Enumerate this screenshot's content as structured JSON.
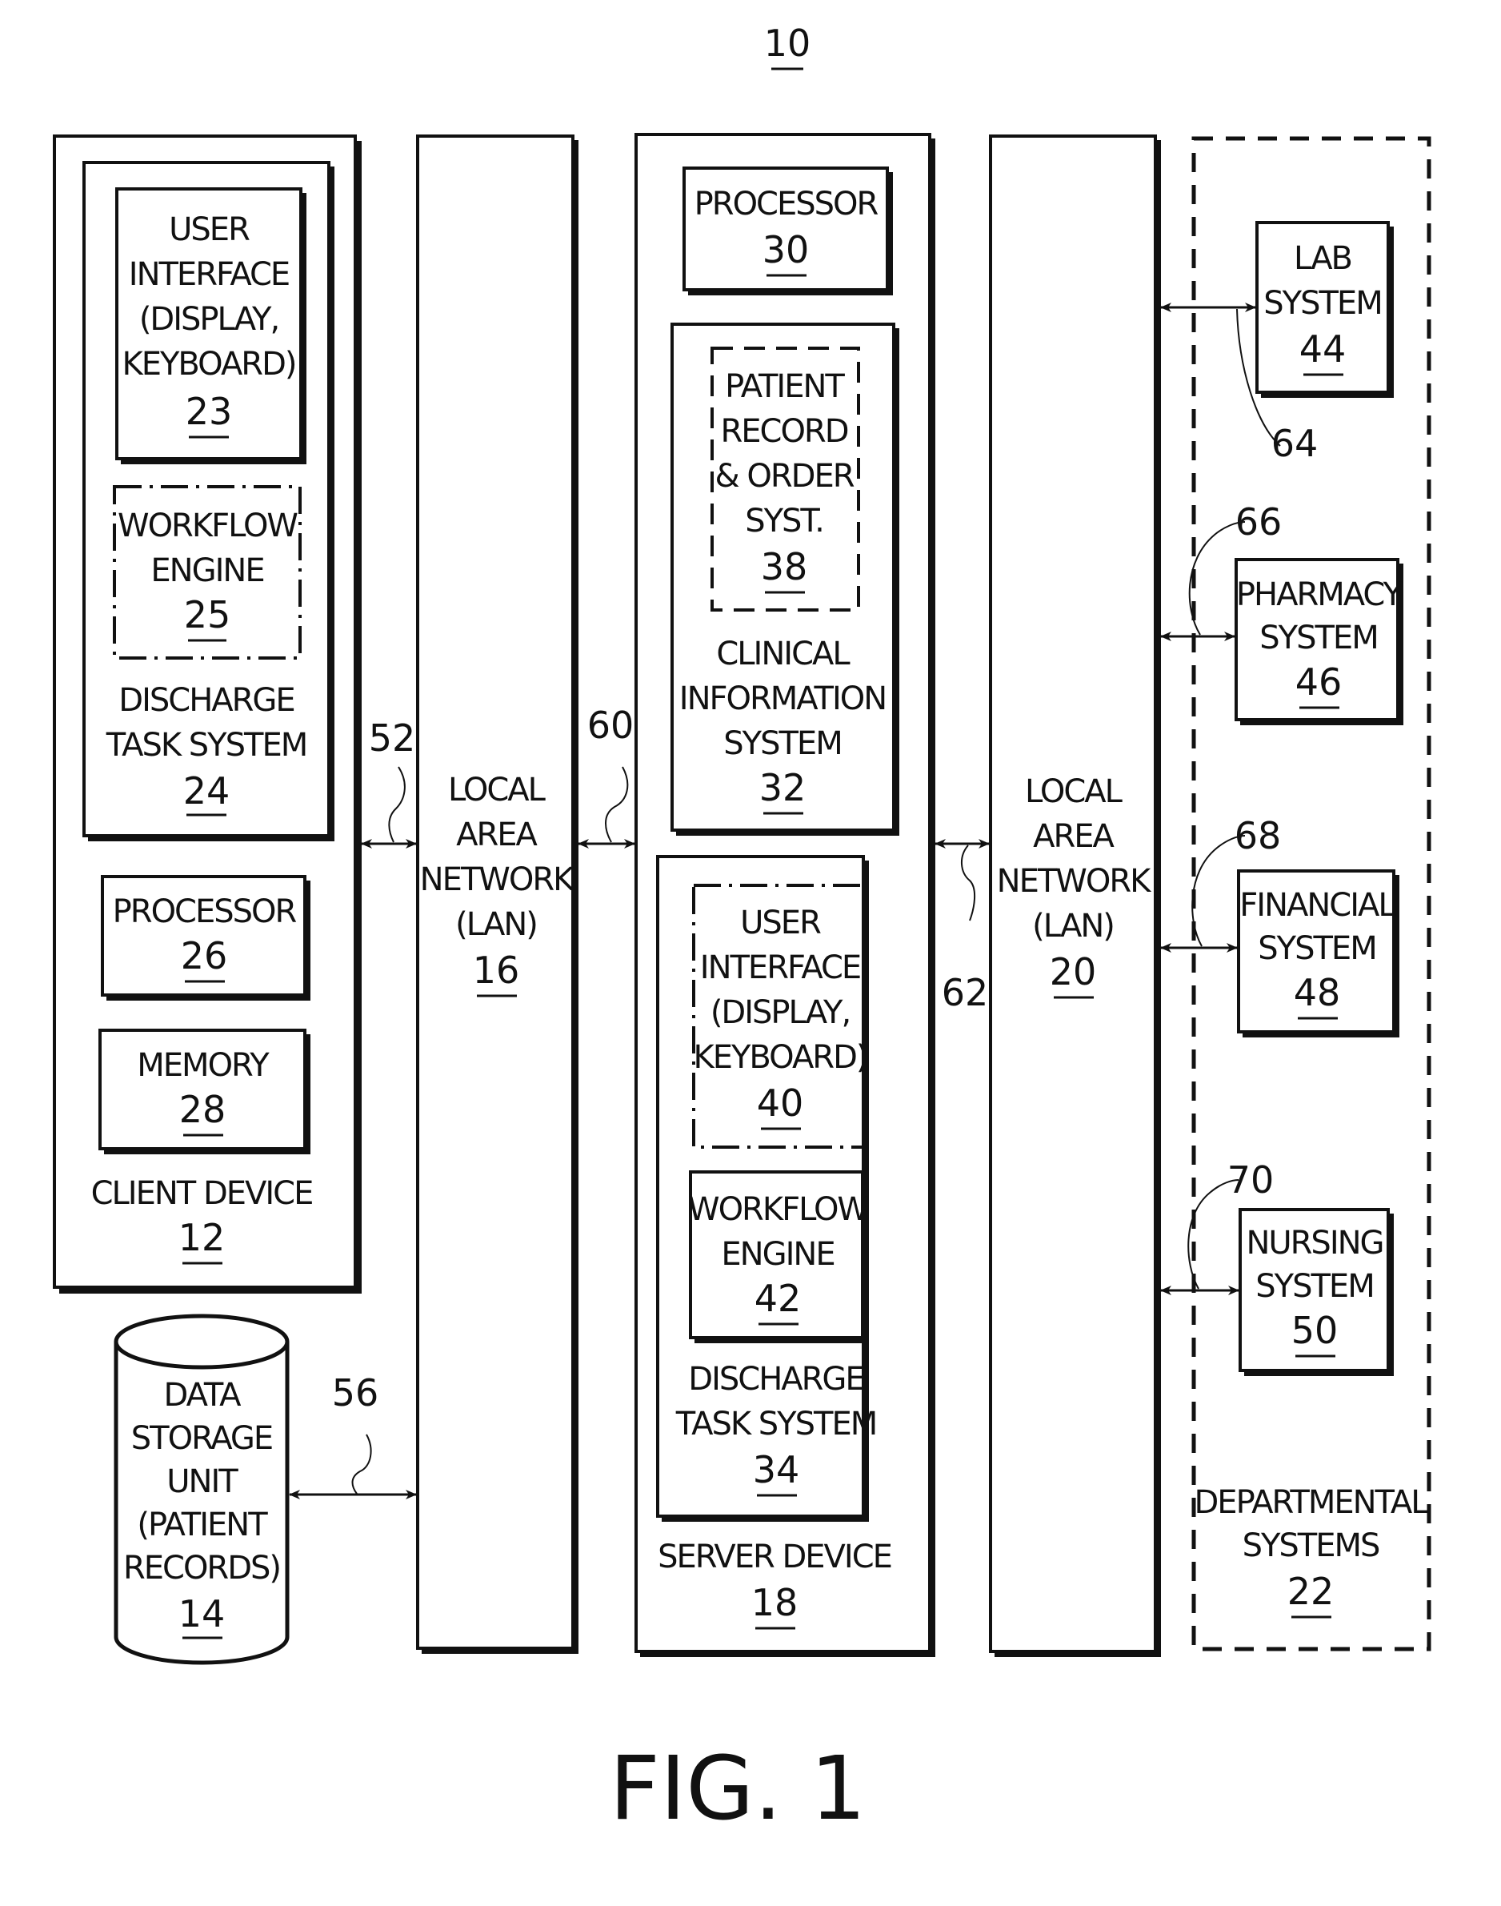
{
  "figure": {
    "reference": "10",
    "caption": "FIG. 1"
  },
  "client_device": {
    "label": "CLIENT DEVICE",
    "ref": "12",
    "discharge_task_system": {
      "lines": [
        "DISCHARGE",
        "TASK SYSTEM"
      ],
      "ref": "24",
      "user_interface": {
        "lines": [
          "USER",
          "INTERFACE",
          "(DISPLAY,",
          "KEYBOARD)"
        ],
        "ref": "23"
      },
      "workflow_engine": {
        "lines": [
          "WORKFLOW",
          "ENGINE"
        ],
        "ref": "25"
      }
    },
    "processor": {
      "label": "PROCESSOR",
      "ref": "26"
    },
    "memory": {
      "label": "MEMORY",
      "ref": "28"
    }
  },
  "data_storage": {
    "lines": [
      "DATA",
      "STORAGE",
      "UNIT",
      "(PATIENT",
      "RECORDS)"
    ],
    "ref": "14"
  },
  "lan_16": {
    "lines": [
      "LOCAL",
      "AREA",
      "NETWORK",
      "(LAN)"
    ],
    "ref": "16"
  },
  "server_device": {
    "label": "SERVER DEVICE",
    "ref": "18",
    "processor": {
      "label": "PROCESSOR",
      "ref": "30"
    },
    "clinical_information_system": {
      "lines": [
        "CLINICAL",
        "INFORMATION",
        "SYSTEM"
      ],
      "ref": "32",
      "patient_record": {
        "lines": [
          "PATIENT",
          "RECORD",
          "& ORDER",
          "SYST."
        ],
        "ref": "38"
      }
    },
    "discharge_task_system": {
      "lines": [
        "DISCHARGE",
        "TASK SYSTEM"
      ],
      "ref": "34",
      "user_interface": {
        "lines": [
          "USER",
          "INTERFACE",
          "(DISPLAY,",
          "KEYBOARD)"
        ],
        "ref": "40"
      },
      "workflow_engine": {
        "lines": [
          "WORKFLOW",
          "ENGINE"
        ],
        "ref": "42"
      }
    }
  },
  "lan_20": {
    "lines": [
      "LOCAL",
      "AREA",
      "NETWORK",
      "(LAN)"
    ],
    "ref": "20"
  },
  "departmental_systems": {
    "lines": [
      "DEPARTMENTAL",
      "SYSTEMS"
    ],
    "ref": "22",
    "lab": {
      "lines": [
        "LAB",
        "SYSTEM"
      ],
      "ref": "44"
    },
    "pharmacy": {
      "lines": [
        "PHARMACY",
        "SYSTEM"
      ],
      "ref": "46"
    },
    "financial": {
      "lines": [
        "FINANCIAL",
        "SYSTEM"
      ],
      "ref": "48"
    },
    "nursing": {
      "lines": [
        "NURSING",
        "SYSTEM"
      ],
      "ref": "50"
    }
  },
  "connections": {
    "c52": "52",
    "c56": "56",
    "c60": "60",
    "c62": "62",
    "c64": "64",
    "c66": "66",
    "c68": "68",
    "c70": "70"
  }
}
